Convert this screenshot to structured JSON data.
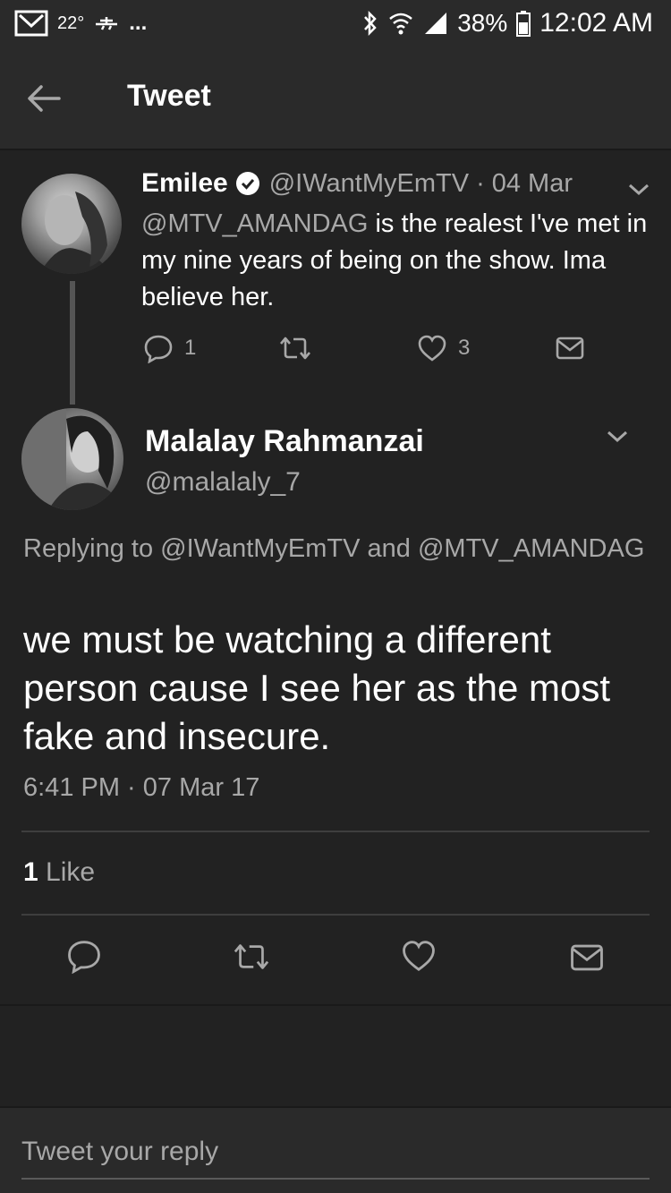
{
  "status_bar": {
    "temperature": "22°",
    "overflow": "...",
    "battery": "38%",
    "time": "12:02 AM",
    "icons": [
      "gmail-icon",
      "weather-icon",
      "bluetooth-icon",
      "wifi-icon",
      "signal-icon",
      "battery-icon"
    ]
  },
  "header": {
    "title": "Tweet"
  },
  "parent_tweet": {
    "name": "Emilee",
    "handle": "@IWantMyEmTV",
    "dot": "·",
    "date": "04 Mar",
    "mention": "@MTV_AMANDAG",
    "text_rest": " is the realest I've met in my nine years of being on the show. Ima believe her.",
    "reply_count": "1",
    "like_count": "3"
  },
  "main_tweet": {
    "name": "Malalay Rahmanzai",
    "handle": "@malalaly_7",
    "replying_prefix": "Replying to ",
    "replying_user1": "@IWantMyEmTV",
    "replying_and": " and ",
    "replying_user2": "@MTV_AMANDAG",
    "text": "we must be watching a different person cause I see her as the most fake and insecure.",
    "timestamp": "6:41 PM · 07 Mar 17",
    "like_number": "1",
    "like_label": " Like"
  },
  "reply": {
    "placeholder": "Tweet your reply"
  }
}
